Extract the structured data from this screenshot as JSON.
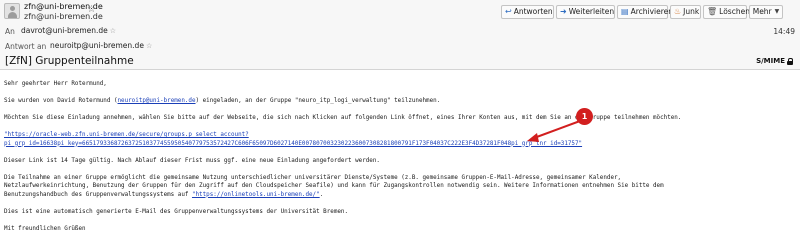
{
  "header": {
    "from_name": "zfn@uni-bremen.de",
    "from_address": "zfn@uni-bremen.de",
    "to_label": "An",
    "to_address": "davrot@uni-bremen.de",
    "time": "14:49",
    "reply_to_label": "Antwort an",
    "reply_to_address": "neuroitp@uni-bremen.de",
    "subject": "[ZfN] Gruppenteilnahme",
    "security_label": "S/MIME"
  },
  "toolbar": {
    "reply": "Antworten",
    "forward": "Weiterleiten",
    "archive": "Archivieren",
    "junk": "Junk",
    "delete": "Löschen",
    "more": "Mehr"
  },
  "icons": {
    "reply": "reply-arrow-icon",
    "forward": "forward-arrow-icon",
    "archive": "archive-box-icon",
    "junk": "flame-icon",
    "delete": "trash-icon",
    "more": "chevron-down-icon",
    "star": "star-icon",
    "avatar": "contact-avatar-icon",
    "lock": "lock-icon"
  },
  "body": {
    "greeting": "Sehr geehrter Herr Rotermund,",
    "p1_before": "Sie wurden von David Rotermund (",
    "p1_link": "neuroitp@uni-bremen.de",
    "p1_after": ") eingeladen, an der Gruppe \"neuro_itp_logi_verwaltung\" teilzunehmen.",
    "p2": "Möchten Sie diese Einladung annehmen, wählen Sie bitte auf der Webseite, die sich nach Klicken auf folgenden Link öffnet, eines Ihrer Konten aus, mit dem Sie an der Gruppe teilnehmen möchten.",
    "link_line1": "\"https://oracle-web.zfn.uni-bremen.de/secure/groups.p_select_account?",
    "link_line2": "pi_grp_id=16638pi_key=6651793368726372510377455950540779753572427C606F65097D6027140E0078070032302236007308281800791F173F04037C222E3F4D37281F048pi_grp_tnr_id=31757\"",
    "p3": "Dieser Link ist 14 Tage gültig. Nach Ablauf dieser Frist muss ggf. eine neue Einladung angefordert werden.",
    "p4_line1": "Die Teilnahme an einer Gruppe ermöglicht die gemeinsame Nutzung unterschiedlicher universitärer Dienste/Systeme (z.B. gemeinsame Gruppen-E-Mail-Adresse, gemeinsamer Kalender,",
    "p4_line2": "Netzlaufwerkeinrichtung, Benutzung der Gruppen für den Zugriff auf den Cloudspeicher Seafile) und kann für Zugangskontrollen notwendig sein. Weitere Informationen entnehmen Sie bitte dem",
    "p4_line3_before": "Benutzungshandbuch des Gruppenverwaltungssystems auf ",
    "p4_line3_link": "\"https://onlinetools.uni-bremen.de/\"",
    "p4_line3_after": ".",
    "p5": "Dies ist eine automatisch generierte E-Mail des Gruppenverwaltungssystems der Universität Bremen.",
    "closing": "Mit freundlichen Grüßen"
  },
  "annotation": {
    "number": "1",
    "color": "#d21f1f"
  }
}
